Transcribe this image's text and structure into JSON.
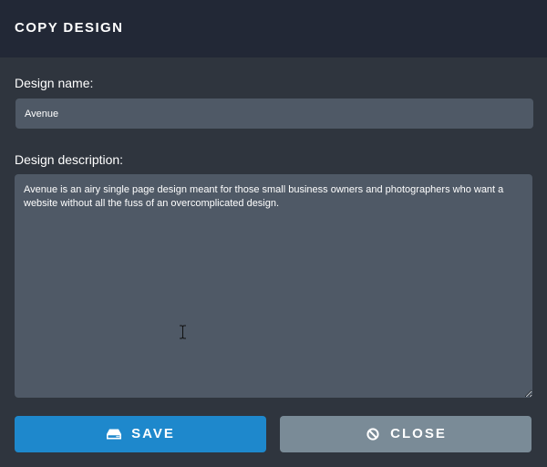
{
  "dialog": {
    "title": "COPY DESIGN"
  },
  "form": {
    "name_label": "Design name:",
    "name_value": "Avenue",
    "description_label": "Design description:",
    "description_value": "Avenue is an airy single page design meant for those small business owners and photographers who want a website without all the fuss of an overcomplicated design."
  },
  "buttons": {
    "save_label": "SAVE",
    "save_icon": "hard-drive-icon",
    "close_label": "CLOSE",
    "close_icon": "ban-icon"
  },
  "colors": {
    "header_bg": "#222836",
    "body_bg": "#2f353e",
    "field_bg": "#4f5966",
    "save_bg": "#1e88cc",
    "close_bg": "#7a8b97",
    "text": "#ffffff"
  }
}
